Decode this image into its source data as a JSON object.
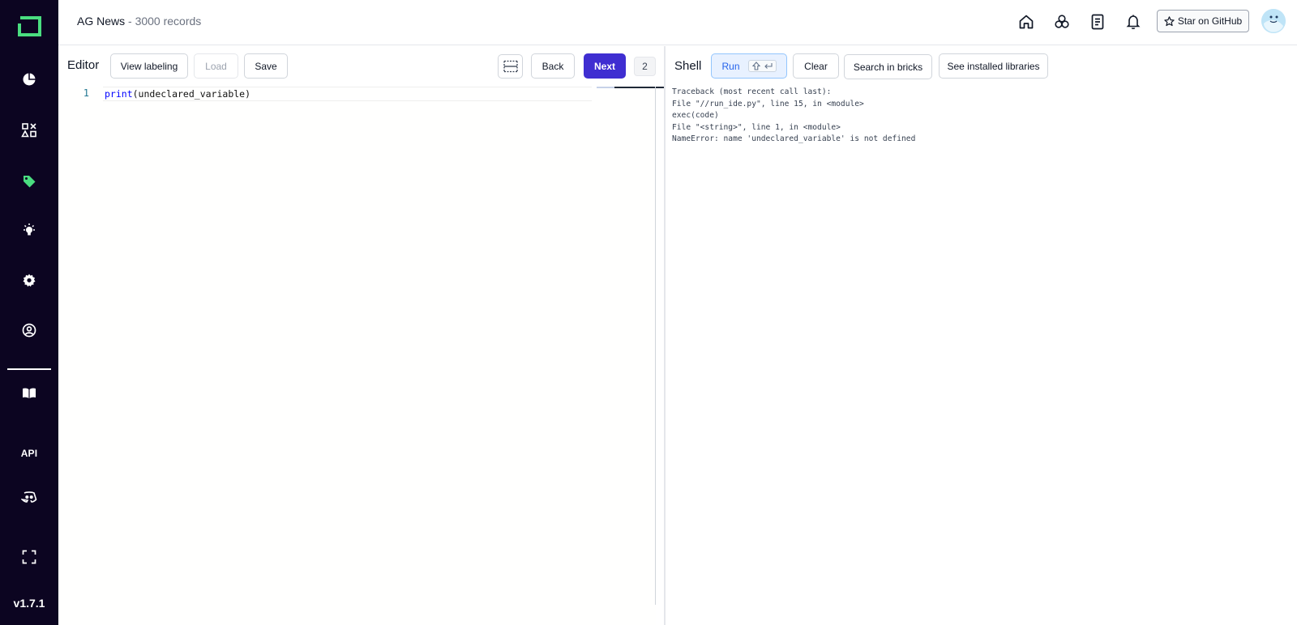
{
  "app": {
    "version": "v1.7.1",
    "accent_color": "#3f2ed1",
    "sidebar_bg": "#0c0521",
    "logo_color": "#4ade80"
  },
  "sidebar": {
    "items": [
      {
        "name": "overview",
        "icon": "pie-chart-icon"
      },
      {
        "name": "data-browser",
        "icon": "shapes-icon"
      },
      {
        "name": "labeling",
        "icon": "tag-icon",
        "active": true
      },
      {
        "name": "heuristics",
        "icon": "lightbulb-icon"
      },
      {
        "name": "settings",
        "icon": "gear-icon"
      },
      {
        "name": "users",
        "icon": "user-circle-icon"
      }
    ],
    "bottom_items": [
      {
        "name": "docs",
        "icon": "book-icon"
      },
      {
        "name": "api",
        "label": "API"
      },
      {
        "name": "discord",
        "icon": "discord-icon"
      },
      {
        "name": "fullscreen",
        "icon": "fullscreen-icon"
      }
    ],
    "api_label": "API"
  },
  "header": {
    "project_name": "AG News",
    "project_records": " - 3000 records",
    "icons": [
      "home-icon",
      "network-icon",
      "document-icon",
      "bell-icon"
    ],
    "github_label": "Star on GitHub"
  },
  "editor": {
    "title": "Editor",
    "view_labeling_label": "View labeling",
    "load_label": "Load",
    "save_label": "Save",
    "back_label": "Back",
    "next_label": "Next",
    "counter": "2",
    "line_number": "1",
    "code_keyword": "print",
    "code_rest": "(undeclared_variable)"
  },
  "shell": {
    "title": "Shell",
    "run_label": "Run",
    "clear_label": "Clear",
    "search_bricks_label": "Search in bricks",
    "installed_libs_label": "See installed libraries",
    "output": [
      "Traceback (most recent call last):",
      "File \"//run_ide.py\", line 15, in <module>",
      "exec(code)",
      "File \"<string>\", line 1, in <module>",
      "NameError: name 'undeclared_variable' is not defined"
    ]
  }
}
